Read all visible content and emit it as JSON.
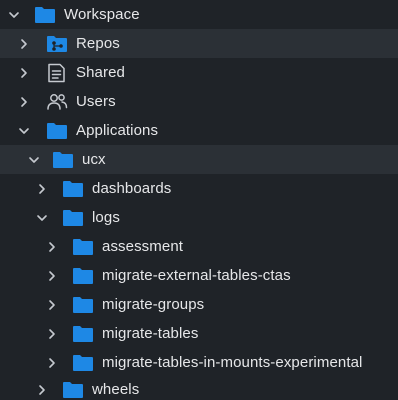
{
  "tree": {
    "nodes": [
      {
        "label": "Workspace",
        "icon": "folder-icon",
        "expanded": true
      },
      {
        "label": "Repos",
        "icon": "repo-folder-icon",
        "expanded": false
      },
      {
        "label": "Shared",
        "icon": "shared-document-icon",
        "expanded": false
      },
      {
        "label": "Users",
        "icon": "users-icon",
        "expanded": false
      },
      {
        "label": "Applications",
        "icon": "folder-icon",
        "expanded": true
      },
      {
        "label": "ucx",
        "icon": "folder-icon",
        "expanded": true
      },
      {
        "label": "dashboards",
        "icon": "folder-icon",
        "expanded": false
      },
      {
        "label": "logs",
        "icon": "folder-icon",
        "expanded": true
      },
      {
        "label": "assessment",
        "icon": "folder-icon",
        "expanded": false
      },
      {
        "label": "migrate-external-tables-ctas",
        "icon": "folder-icon",
        "expanded": false
      },
      {
        "label": "migrate-groups",
        "icon": "folder-icon",
        "expanded": false
      },
      {
        "label": "migrate-tables",
        "icon": "folder-icon",
        "expanded": false
      },
      {
        "label": "migrate-tables-in-mounts-experimental",
        "icon": "folder-icon",
        "expanded": false
      },
      {
        "label": "wheels",
        "icon": "folder-icon",
        "expanded": false
      }
    ]
  },
  "colors": {
    "background": "#1f2328",
    "highlight": "#2b3036",
    "folder": "#1e88e5",
    "text": "#e6e7e9",
    "chevron": "#c5c9cf"
  }
}
